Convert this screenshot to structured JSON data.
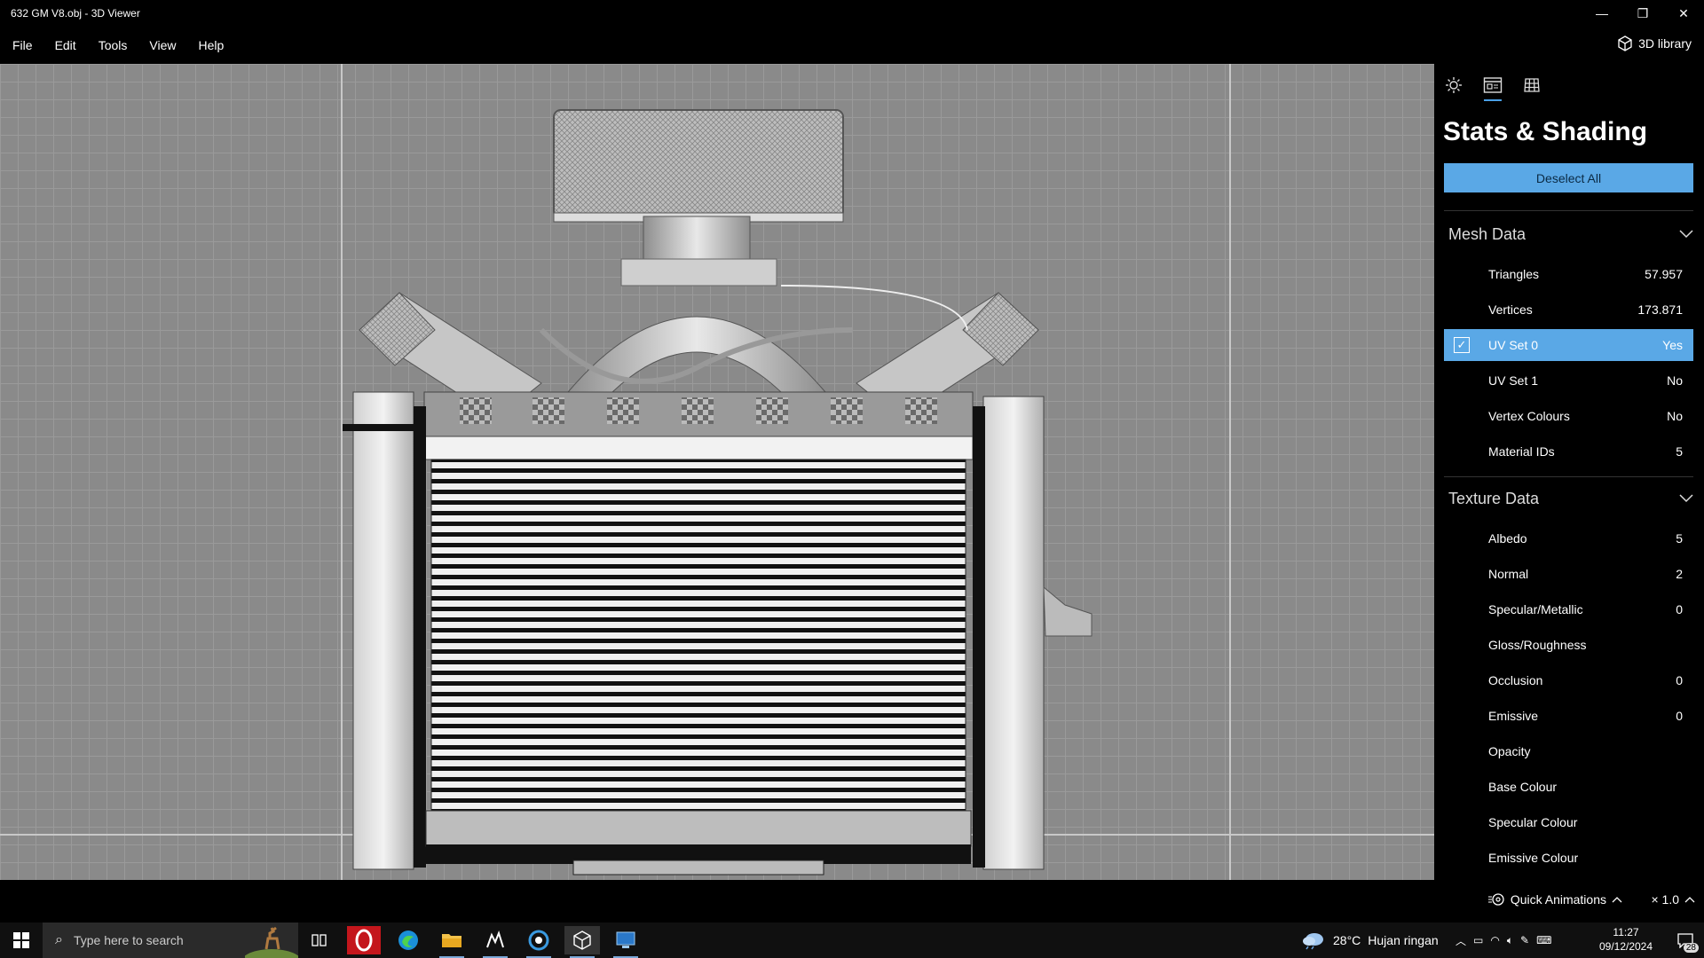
{
  "window": {
    "title": "632 GM V8.obj - 3D Viewer",
    "controls": {
      "minimize": "—",
      "restore": "❐",
      "close": "✕"
    }
  },
  "menu": {
    "items": [
      "File",
      "Edit",
      "Tools",
      "View",
      "Help"
    ],
    "library_label": "3D library"
  },
  "panel": {
    "tabs": [
      "sun-icon",
      "stats-icon",
      "grid-icon"
    ],
    "active_tab": 1,
    "title": "Stats & Shading",
    "deselect_label": "Deselect All",
    "mesh_section": "Mesh Data",
    "mesh_rows": [
      {
        "label": "Triangles",
        "value": "57.957"
      },
      {
        "label": "Vertices",
        "value": "173.871"
      },
      {
        "label": "UV Set 0",
        "value": "Yes",
        "selected": true,
        "checked": true
      },
      {
        "label": "UV Set 1",
        "value": "No"
      },
      {
        "label": "Vertex Colours",
        "value": "No"
      },
      {
        "label": "Material IDs",
        "value": "5"
      }
    ],
    "texture_section": "Texture Data",
    "texture_rows": [
      {
        "label": "Albedo",
        "value": "5"
      },
      {
        "label": "Normal",
        "value": "2"
      },
      {
        "label": "Specular/Metallic",
        "value": "0"
      },
      {
        "label": "Gloss/Roughness",
        "value": ""
      },
      {
        "label": "Occlusion",
        "value": "0"
      },
      {
        "label": "Emissive",
        "value": "0"
      },
      {
        "label": "Opacity",
        "value": ""
      },
      {
        "label": "Base Colour",
        "value": ""
      },
      {
        "label": "Specular Colour",
        "value": ""
      },
      {
        "label": "Emissive Colour",
        "value": ""
      }
    ]
  },
  "status": {
    "quick_animations": "Quick Animations",
    "speed": "× 1.0"
  },
  "taskbar": {
    "search_placeholder": "Type here to search",
    "weather_temp": "28°C",
    "weather_desc": "Hujan ringan",
    "time": "11:27",
    "date": "09/12/2024",
    "notification_count": "28"
  },
  "colors": {
    "accent": "#5aa8e6",
    "viewport_bg": "#8a8a8a"
  }
}
